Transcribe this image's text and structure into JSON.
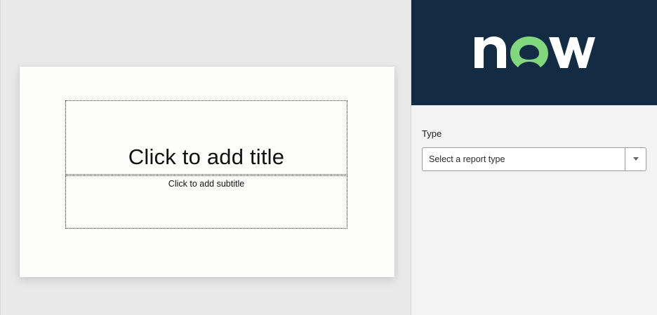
{
  "slide": {
    "title_placeholder": "Click to add title",
    "subtitle_placeholder": "Click to add subtitle"
  },
  "panel": {
    "brand": {
      "logo_text": "now",
      "colors": {
        "header_bg": "#132c44",
        "logo_white": "#ffffff",
        "logo_green": "#81d67e"
      }
    },
    "type_field": {
      "label": "Type",
      "placeholder": "Select a report type"
    }
  },
  "icons": {
    "dropdown": "chevron-down-icon"
  }
}
